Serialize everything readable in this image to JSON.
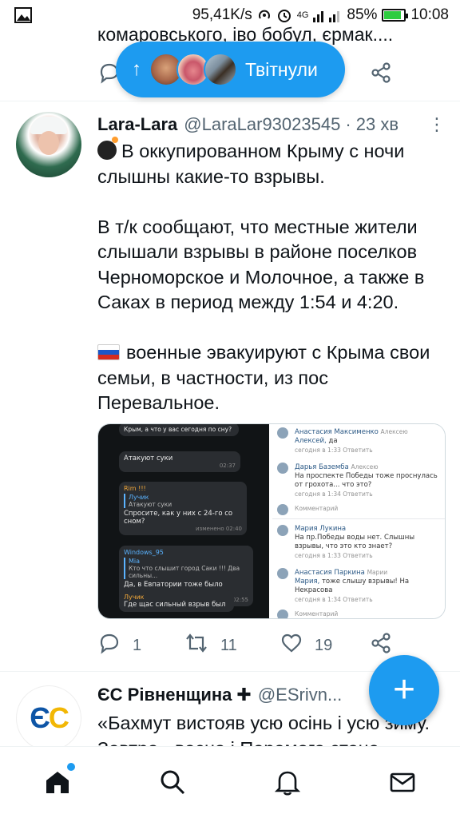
{
  "status_bar": {
    "speed": "95,41K/s",
    "network": "4G",
    "battery": "85%",
    "time": "10:08",
    "battery_level": 0.85
  },
  "previous_tweet": {
    "text_tail": "комаровського, іво бобул, єрмак...."
  },
  "tweeted_pill": {
    "arrow": "↑",
    "label": "Твітнули"
  },
  "tweet": {
    "author_name": "Lara-Lara",
    "author_handle": "@LaraLar93023545",
    "time": "· 23 хв",
    "more": "⋮",
    "paragraph1": "В оккупированном Крыму с ночи слышны какие-то взрывы.",
    "paragraph2": "В т/к сообщают, что местные жители слышали взрывы в районе поселков Черноморское и Молочное, а также в Саках в период между 1:54 и 4:20.",
    "paragraph3": "военные эвакуируют с Крыма свои семьи, в частности, из пос Перевальное.",
    "media_left": {
      "top_line": "Крым, а что у вас сегодня по сну?",
      "attack_text": "Атакуют суки",
      "attack_time": "02:37",
      "rim_name": "Rim !!!",
      "rim_reply_name": "Лучик",
      "rim_reply_text": "Атакуют суки",
      "rim_text": "Спросите, как у них с 24-го со сном?",
      "rim_time": "изменено 02:40",
      "windows_name": "Windows_95",
      "windows_reply_name": "Mia",
      "windows_reply_text": "Кто что слышит город Саки !!! Два сильны...",
      "windows_text": "Да, в Евпатории тоже было слышно.",
      "windows_time": "02:55",
      "luchik_name": "Лучик",
      "luchik_text": "Где щас сильный взрыв был",
      "luchik_time": "03:03"
    },
    "media_right": {
      "c1_name": "Анастасия Максименко",
      "c1_to": "Алексею",
      "c1_text_addr": "Алексей,",
      "c1_text": "да",
      "c1_meta": "сегодня в 1:33   Ответить",
      "c2_name": "Дарья Баземба",
      "c2_to": "Алексею",
      "c2_text": "На проспекте Победы тоже проснулась от грохота... что это?",
      "c2_meta": "сегодня в 1:34   Ответить",
      "comment_placeholder_1": "Комментарий",
      "c3_name": "Мария Лукина",
      "c3_text": "На пр.Победы воды нет.  Слышны взрывы, что это кто знает?",
      "c3_meta": "сегодня в 1:33   Ответить",
      "c4_name": "Анастасия Паркина",
      "c4_to": "Марии",
      "c4_text_addr": "Мария,",
      "c4_text": "тоже  слышу взрывы! На Некрасова",
      "c4_meta": "сегодня в 1:34   Ответить",
      "comment_placeholder_2": "Комментарий"
    },
    "replies": "1",
    "retweets": "11",
    "likes": "19"
  },
  "next_tweet": {
    "author_name": "ЄС Рівненщина",
    "author_handle": "@ESrivn...",
    "line1": "«Бахмут вистояв усю осінь і усю зиму.",
    "line2": "Завтра - весна і Перемога стане",
    "logo_text": "ЄС"
  },
  "fab": {
    "label": "+"
  },
  "colors": {
    "accent": "#1d9bf0",
    "text": "#0f1419",
    "muted": "#536471"
  }
}
